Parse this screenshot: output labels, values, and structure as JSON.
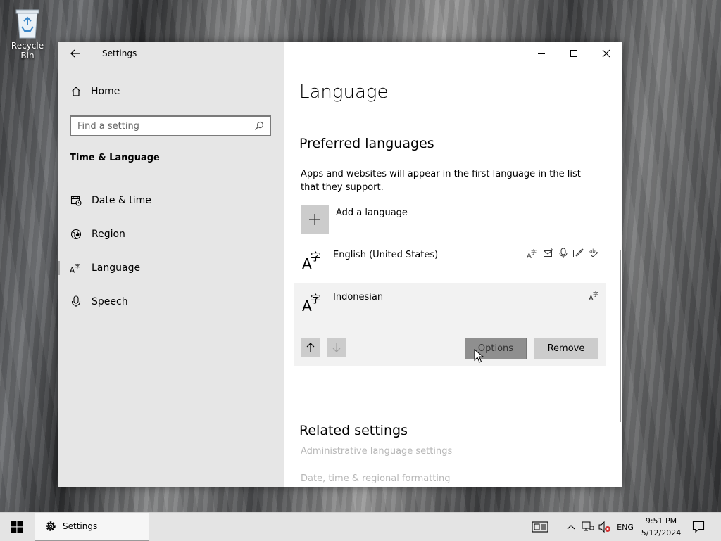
{
  "desktop": {
    "recycle_bin_label": "Recycle Bin"
  },
  "window": {
    "title": "Settings",
    "minimize_label": "Minimize",
    "maximize_label": "Maximize",
    "close_label": "Close"
  },
  "sidebar": {
    "home_label": "Home",
    "search_placeholder": "Find a setting",
    "section_title": "Time & Language",
    "items": [
      {
        "label": "Date & time",
        "icon": "calendar-clock-icon"
      },
      {
        "label": "Region",
        "icon": "globe-icon"
      },
      {
        "label": "Language",
        "icon": "language-icon",
        "selected": true
      },
      {
        "label": "Speech",
        "icon": "microphone-icon"
      }
    ]
  },
  "main": {
    "page_title": "Language",
    "preferred_title": "Preferred languages",
    "preferred_desc": "Apps and websites will appear in the first language in the list that they support.",
    "add_language_label": "Add a language",
    "languages": [
      {
        "name": "English (United States)",
        "features": [
          "display-language-icon",
          "text-to-speech-icon",
          "speech-recognition-icon",
          "handwriting-icon",
          "spell-check-icon"
        ]
      },
      {
        "name": "Indonesian",
        "features": [
          "display-language-icon"
        ],
        "expanded": true
      }
    ],
    "options_button": "Options",
    "remove_button": "Remove",
    "related_title": "Related settings",
    "related_links": [
      "Administrative language settings",
      "Date, time & regional formatting"
    ]
  },
  "taskbar": {
    "app_label": "Settings",
    "language_indicator": "ENG",
    "time": "9:51 PM",
    "date": "5/12/2024"
  }
}
